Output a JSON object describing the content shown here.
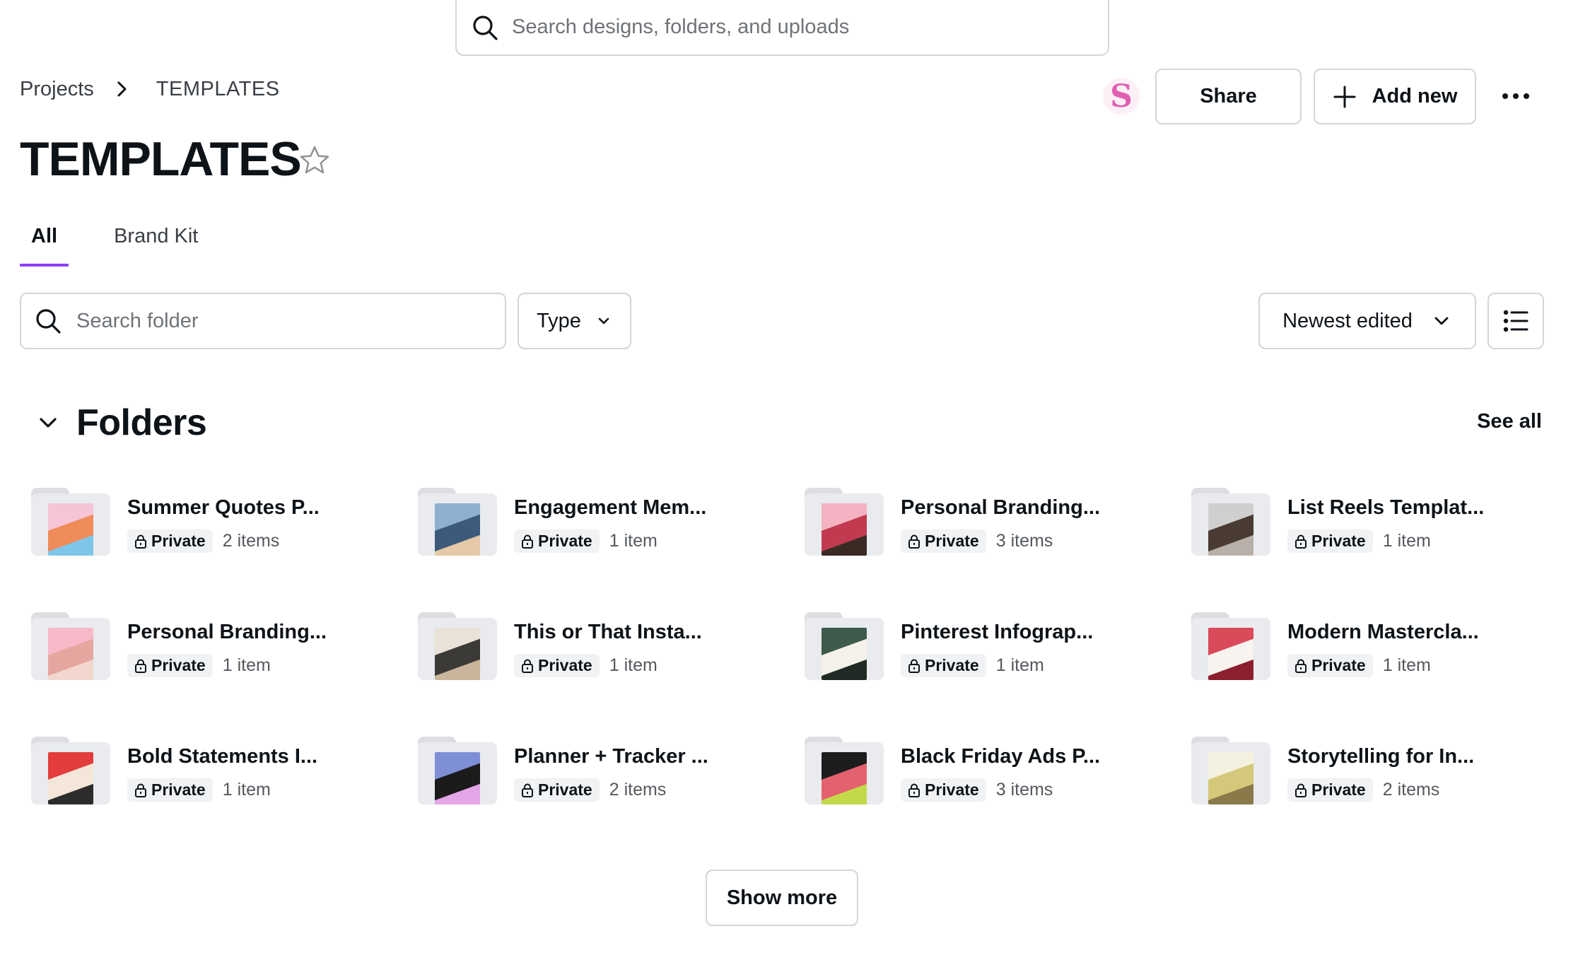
{
  "top_search": {
    "placeholder": "Search designs, folders, and uploads",
    "icon": "search-icon"
  },
  "breadcrumb": {
    "parent": "Projects",
    "current": "TEMPLATES"
  },
  "header": {
    "avatar_letter": "S",
    "share_label": "Share",
    "add_new_label": "Add new",
    "more_icon": "more-horizontal-icon"
  },
  "page": {
    "title": "TEMPLATES"
  },
  "tabs": [
    {
      "label": "All",
      "active": true
    },
    {
      "label": "Brand Kit",
      "active": false
    }
  ],
  "filters": {
    "search_placeholder": "Search folder",
    "type_label": "Type",
    "sort_label": "Newest edited",
    "view_icon": "list-view-icon"
  },
  "folders_section": {
    "title": "Folders",
    "see_all_label": "See all",
    "items": [
      {
        "name": "Summer Quotes P...",
        "privacy": "Private",
        "count": "2 items",
        "colors": [
          "#f6c4d6",
          "#f08b5a",
          "#7ec6e8"
        ]
      },
      {
        "name": "Engagement Mem...",
        "privacy": "Private",
        "count": "1 item",
        "colors": [
          "#8fb1cf",
          "#3d5a7a",
          "#e6c9a8"
        ]
      },
      {
        "name": "Personal Branding...",
        "privacy": "Private",
        "count": "3 items",
        "colors": [
          "#f4b3c2",
          "#c23a4f",
          "#3a2a24"
        ]
      },
      {
        "name": "List Reels Templat...",
        "privacy": "Private",
        "count": "1 item",
        "colors": [
          "#cfcfcf",
          "#4a3a34",
          "#b8b0a8"
        ]
      },
      {
        "name": "Personal Branding...",
        "privacy": "Private",
        "count": "1 item",
        "colors": [
          "#f7b8c8",
          "#e6a6a0",
          "#f3d7cf"
        ]
      },
      {
        "name": "This or That Insta...",
        "privacy": "Private",
        "count": "1 item",
        "colors": [
          "#e8e2d8",
          "#3c3a36",
          "#c9b59b"
        ]
      },
      {
        "name": "Pinterest Infograp...",
        "privacy": "Private",
        "count": "1 item",
        "colors": [
          "#3d5a4a",
          "#f4f1ea",
          "#1f2a24"
        ]
      },
      {
        "name": "Modern Mastercla...",
        "privacy": "Private",
        "count": "1 item",
        "colors": [
          "#d94a5a",
          "#f7f3ee",
          "#8b1f2e"
        ]
      },
      {
        "name": "Bold Statements I...",
        "privacy": "Private",
        "count": "1 item",
        "colors": [
          "#e23c3c",
          "#f4e6d8",
          "#2c2c2c"
        ]
      },
      {
        "name": "Planner + Tracker ...",
        "privacy": "Private",
        "count": "2 items",
        "colors": [
          "#7e8fd6",
          "#1b1b1b",
          "#e3a6e8"
        ]
      },
      {
        "name": "Black Friday Ads P...",
        "privacy": "Private",
        "count": "3 items",
        "colors": [
          "#1c1c1c",
          "#e3616e",
          "#c4d94a"
        ]
      },
      {
        "name": "Storytelling for In...",
        "privacy": "Private",
        "count": "2 items",
        "colors": [
          "#f5f1e0",
          "#d4c87a",
          "#8a7a4a"
        ]
      }
    ]
  },
  "show_more_label": "Show more"
}
